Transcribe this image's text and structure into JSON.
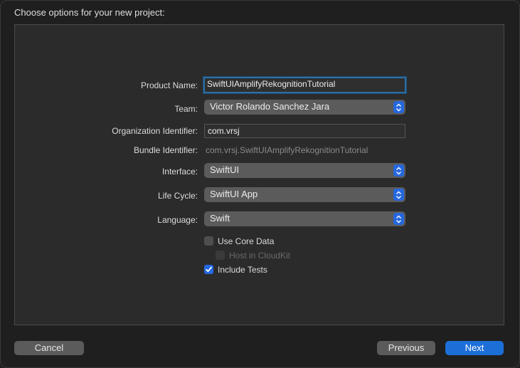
{
  "heading": "Choose options for your new project:",
  "form": {
    "product_name": {
      "label": "Product Name:",
      "value": "SwiftUIAmplifyRekognitionTutorial"
    },
    "team": {
      "label": "Team:",
      "value": "Victor Rolando Sanchez Jara"
    },
    "organization_identifier": {
      "label": "Organization Identifier:",
      "value": "com.vrsj"
    },
    "bundle_identifier": {
      "label": "Bundle Identifier:",
      "value": "com.vrsj.SwiftUIAmplifyRekognitionTutorial"
    },
    "interface": {
      "label": "Interface:",
      "value": "SwiftUI"
    },
    "life_cycle": {
      "label": "Life Cycle:",
      "value": "SwiftUI App"
    },
    "language": {
      "label": "Language:",
      "value": "Swift"
    }
  },
  "options": [
    {
      "label": "Use Core Data",
      "checked": false,
      "enabled": true
    },
    {
      "label": "Host in CloudKit",
      "checked": false,
      "enabled": false
    },
    {
      "label": "Include Tests",
      "checked": true,
      "enabled": true
    }
  ],
  "buttons": {
    "cancel": "Cancel",
    "previous": "Previous",
    "next": "Next"
  },
  "colors": {
    "accent": "#2568e0",
    "primary_button": "#1d6fd8"
  }
}
